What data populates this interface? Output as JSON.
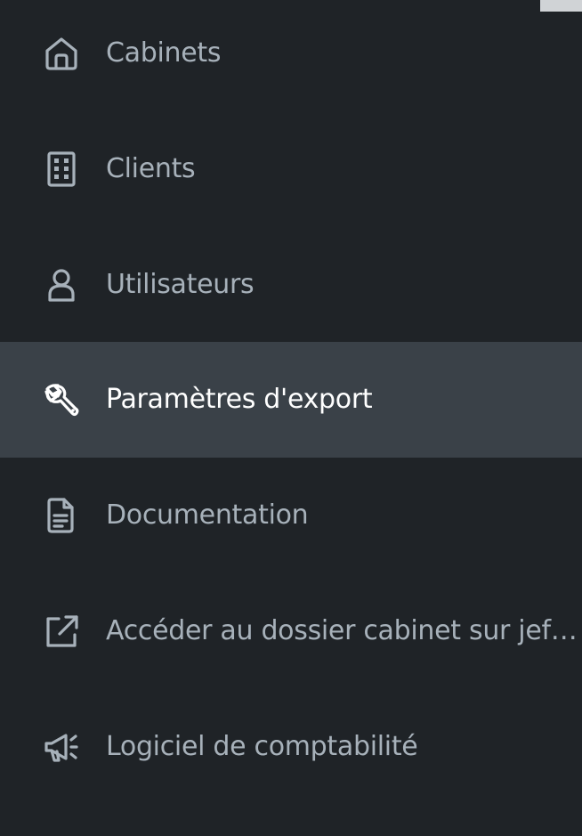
{
  "nav": {
    "items": [
      {
        "label": "Cabinets",
        "icon": "home-icon",
        "active": false
      },
      {
        "label": "Clients",
        "icon": "building-icon",
        "active": false
      },
      {
        "label": "Utilisateurs",
        "icon": "user-icon",
        "active": false
      },
      {
        "label": "Paramètres d'export",
        "icon": "wrench-icon",
        "active": true
      },
      {
        "label": "Documentation",
        "icon": "document-icon",
        "active": false
      },
      {
        "label": "Accéder au dossier cabinet sur jefa…",
        "icon": "external-link-icon",
        "active": false
      },
      {
        "label": "Logiciel de comptabilité",
        "icon": "megaphone-icon",
        "active": false
      }
    ]
  },
  "colors": {
    "background": "#1f2327",
    "active_background": "#3a4148",
    "text": "#a7b1ba",
    "active_text": "#ffffff"
  }
}
